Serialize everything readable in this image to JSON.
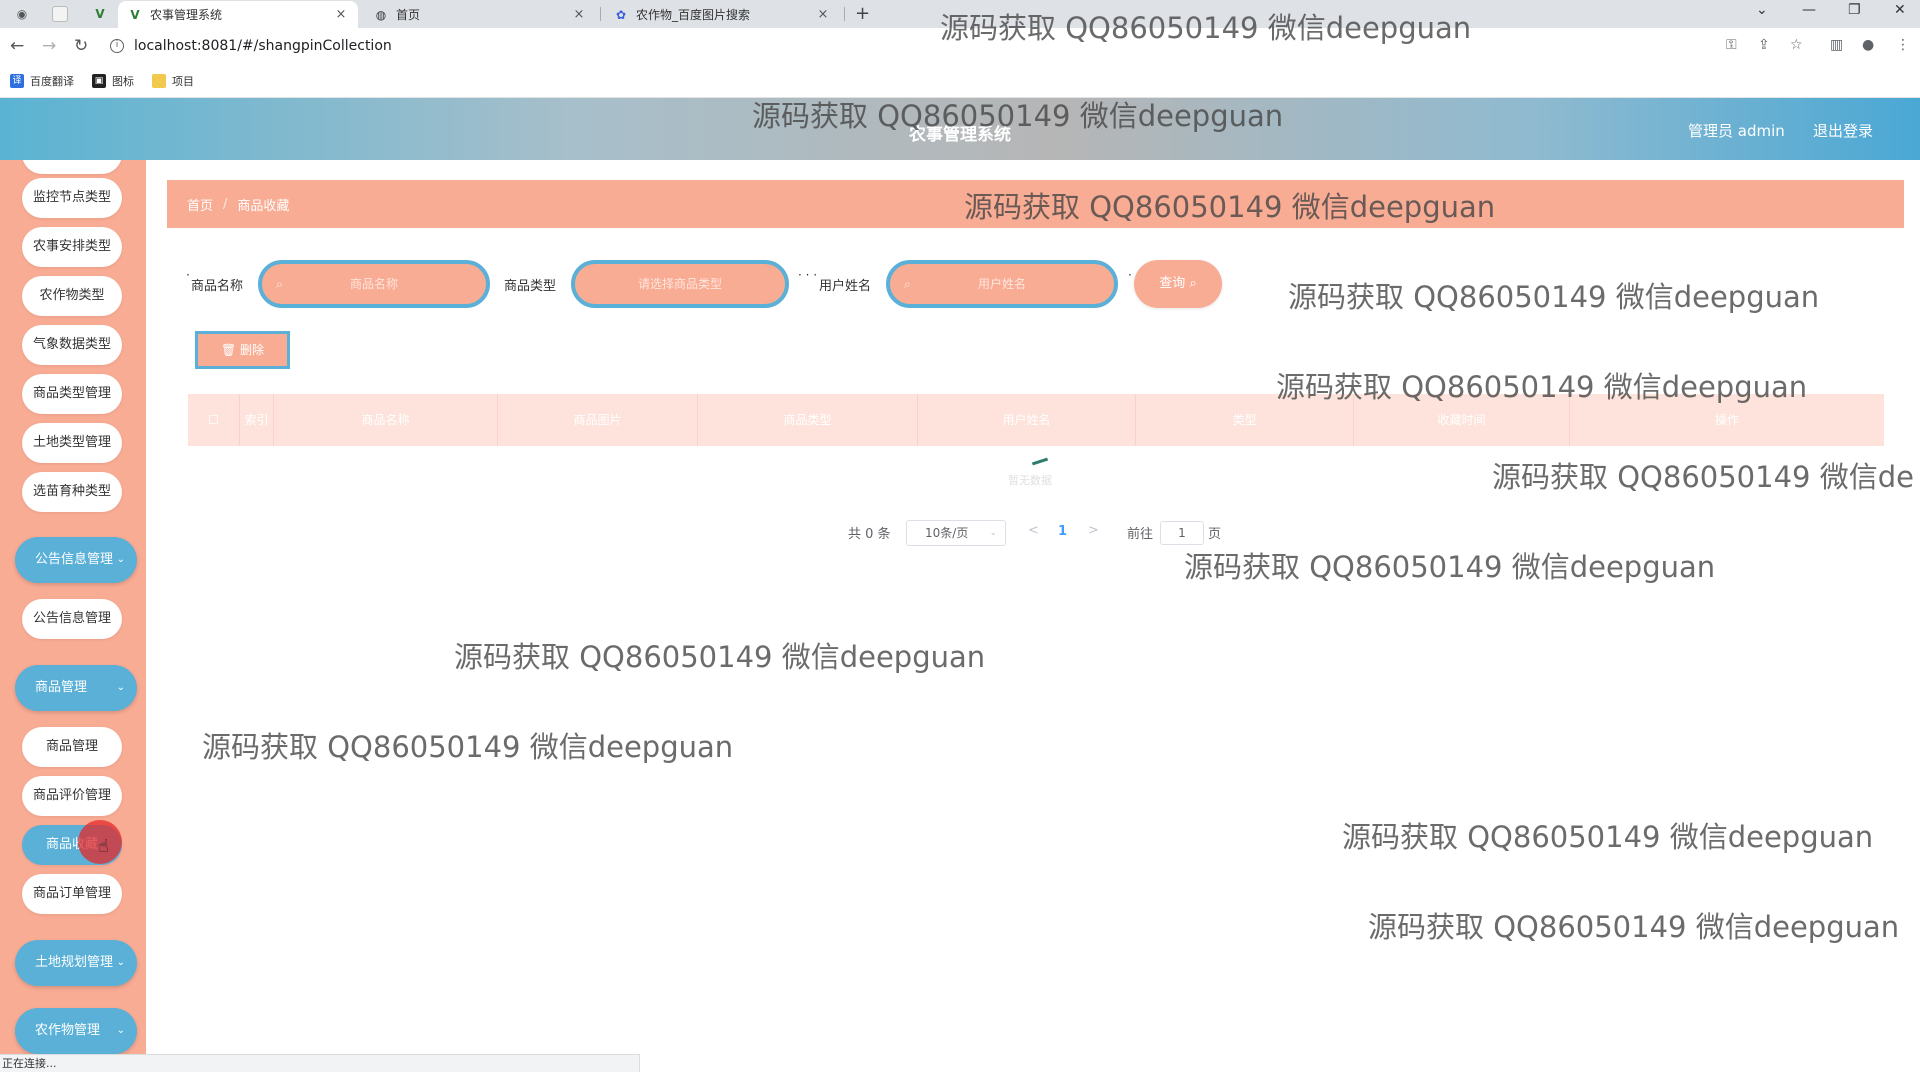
{
  "browser": {
    "tabs": [
      {
        "title": "农事管理系统",
        "close": "×"
      },
      {
        "title": "首页",
        "close": "×"
      },
      {
        "title": "农作物_百度图片搜索",
        "close": "×"
      }
    ],
    "new_tab": "+",
    "url": "localhost:8081/#/shangpinCollection",
    "bookmarks": [
      "百度翻译",
      "图标",
      "项目"
    ],
    "status": "正在连接..."
  },
  "header": {
    "title": "农事管理系统",
    "user": "管理员 admin",
    "logout": "退出登录"
  },
  "sidebar": {
    "items_top": [
      "监控节点类型",
      "农事安排类型",
      "农作物类型",
      "气象数据类型",
      "商品类型管理",
      "土地类型管理",
      "选苗育种类型"
    ],
    "group_notice": "公告信息管理",
    "notice_items": [
      "公告信息管理"
    ],
    "group_goods": "商品管理",
    "goods_items": [
      "商品管理",
      "商品评价管理",
      "商品收藏",
      "商品订单管理"
    ],
    "active_item": "商品收藏",
    "group_land": "土地规划管理",
    "group_crop": "农作物管理"
  },
  "breadcrumb": {
    "home": "首页",
    "sep": "/",
    "current": "商品收藏"
  },
  "filters": {
    "name_label": "商品名称",
    "name_placeholder": "商品名称",
    "type_label": "商品类型",
    "type_placeholder": "请选择商品类型",
    "user_label": "用户姓名",
    "user_placeholder": "用户姓名",
    "query_label": "查询"
  },
  "actions": {
    "delete_label": "删除"
  },
  "table": {
    "columns": [
      "",
      "索引",
      "商品名称",
      "商品图片",
      "商品类型",
      "用户姓名",
      "类型",
      "收藏时间",
      "操作"
    ],
    "empty_text": "暂无数据"
  },
  "pagination": {
    "total": "共 0 条",
    "page_size": "10条/页",
    "prev": "<",
    "current_page": "1",
    "next": ">",
    "goto_label": "前往",
    "goto_value": "1",
    "page_suffix": "页"
  },
  "watermark": "源码获取 QQ86050149 微信deepguan",
  "watermark_partial": "源码获取 QQ86050149 微信de"
}
